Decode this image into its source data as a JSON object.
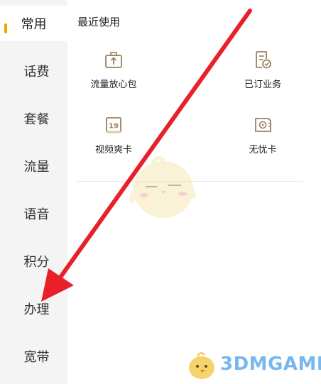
{
  "sidebar": {
    "items": [
      {
        "label": "常用",
        "active": true
      },
      {
        "label": "话费"
      },
      {
        "label": "套餐"
      },
      {
        "label": "流量"
      },
      {
        "label": "语音"
      },
      {
        "label": "积分"
      },
      {
        "label": "办理"
      },
      {
        "label": "宽带"
      }
    ]
  },
  "main": {
    "section_title": "最近使用",
    "items": [
      {
        "label": "流量放心包",
        "icon": "briefcase-upload-icon"
      },
      {
        "label": "已订业务",
        "icon": "subscribed-doc-icon"
      },
      {
        "label": "视频爽卡",
        "icon": "sim-card-19-icon"
      },
      {
        "label": "无忧卡",
        "icon": "sim-card-chip-icon"
      }
    ]
  },
  "watermark": {
    "text": "3DMGAME"
  },
  "colors": {
    "accent": "#f0a500",
    "arrow": "#e8202a",
    "icon": "#9a8060",
    "sidebar_bg": "#f4f4f4"
  }
}
